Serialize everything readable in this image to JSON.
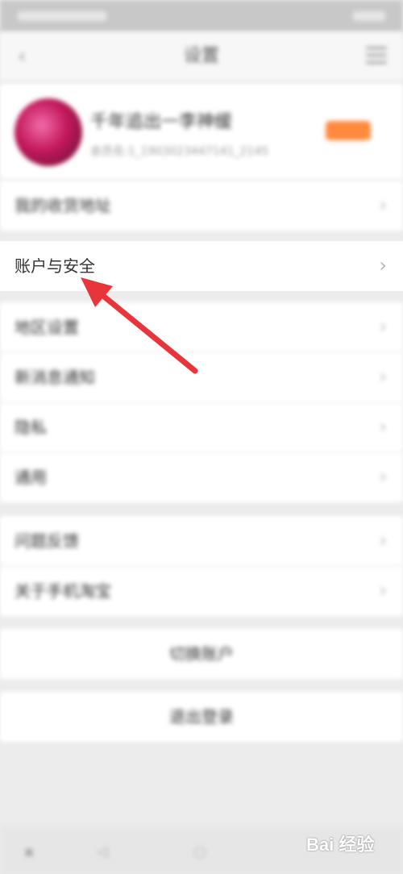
{
  "status_bar": {},
  "nav": {
    "back_icon": "back-chevron-icon",
    "title": "设置",
    "menu_icon": "menu-icon"
  },
  "profile": {
    "name": "千年追出一李神缓",
    "sub": "会员名:1_1903023447141_2145",
    "badge_color": "#ff8a3d"
  },
  "items": {
    "address": "我的收货地址",
    "account_security": "账户与安全",
    "region": "地区设置",
    "notifications": "新消息通知",
    "privacy": "隐私",
    "general": "通用",
    "feedback": "问题反馈",
    "about": "关于手机淘宝",
    "switch_account": "切换账户",
    "logout": "退出登录"
  },
  "chevron": "›",
  "annotation": {
    "arrow_color": "#e8353b"
  },
  "watermark": {
    "text": "Bai 经验"
  }
}
